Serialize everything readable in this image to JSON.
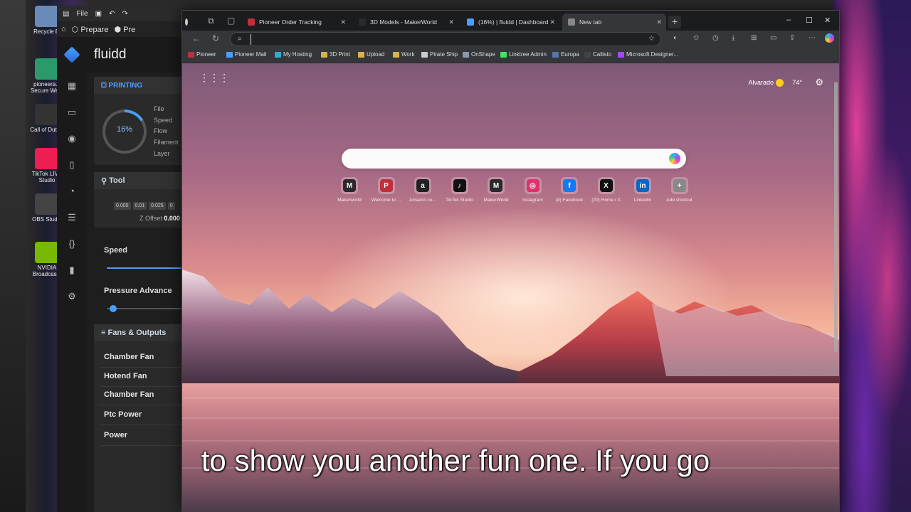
{
  "desktop": {
    "icons": [
      {
        "label": "Recycle Bi",
        "color": "#6a8ab8"
      },
      {
        "label": "pioneera... Secure We...",
        "color": "#2a9a6a"
      },
      {
        "label": "Call of Duty®",
        "color": "#333333"
      },
      {
        "label": "TikTok LIVE Studio",
        "color": "#ee1d52"
      },
      {
        "label": "OBS Studio",
        "color": "#444444"
      },
      {
        "label": "NVIDIA Broadcas...",
        "color": "#76b900"
      }
    ]
  },
  "fluidd": {
    "topbar": {
      "file": "File"
    },
    "tabs": {
      "prepare": "Prepare",
      "preview": "Pre"
    },
    "brand": "fluidd",
    "printing": {
      "header": "PRINTING",
      "progress_label": "16%",
      "progress": 0.16,
      "stats": [
        "File",
        "Speed",
        "Flow",
        "Filament",
        "Layer"
      ]
    },
    "tool": {
      "header": "Tool",
      "z_steps": [
        "0.005",
        "0.01",
        "0.025",
        "0"
      ],
      "z_offset_label": "Z Offset",
      "z_offset_value": "0.000"
    },
    "speed_label": "Speed",
    "pressure_label": "Pressure Advance",
    "fans": {
      "header": "Fans & Outputs",
      "items": [
        "Chamber Fan",
        "Hotend Fan",
        "Chamber Fan",
        "Ptc Power",
        "Power"
      ]
    }
  },
  "browser": {
    "tabs": [
      {
        "title": "Pioneer Order Tracking",
        "color": "#c0303a"
      },
      {
        "title": "3D Models - MakerWorld",
        "color": "#2a2a2a"
      },
      {
        "title": "(16%) | fluidd | Dashboard",
        "color": "#4a9eff"
      },
      {
        "title": "New tab",
        "color": "#888888"
      }
    ],
    "new_tab_symbol": "+",
    "window_controls": [
      "–",
      "☐",
      "✕"
    ],
    "omnibox": {
      "value": "",
      "placeholder": ""
    },
    "bookmarks": [
      {
        "label": "Pioneer",
        "color": "#c0303a"
      },
      {
        "label": "Pioneer Mail",
        "color": "#4a9eff"
      },
      {
        "label": "My Hosting",
        "color": "#33aacc"
      },
      {
        "label": "3D Print",
        "color": "#d9b34a"
      },
      {
        "label": "Upload",
        "color": "#d9b34a"
      },
      {
        "label": "Work",
        "color": "#d9b34a"
      },
      {
        "label": "Pirate Ship",
        "color": "#cccccc"
      },
      {
        "label": "OnShape",
        "color": "#8899aa"
      },
      {
        "label": "Linktree Admin",
        "color": "#43e55e"
      },
      {
        "label": "Europa",
        "color": "#5577aa"
      },
      {
        "label": "Callisto",
        "color": "#444444"
      },
      {
        "label": "Microsoft Designer...",
        "color": "#a14aff"
      }
    ]
  },
  "ntp": {
    "user": "Alvarado",
    "temperature": "74°",
    "search_placeholder": "",
    "shortcuts": [
      {
        "label": "Makerworld",
        "glyph": "M",
        "color": "#2a2a2a"
      },
      {
        "label": "Welcome to ...",
        "glyph": "P",
        "color": "#c0303a"
      },
      {
        "label": "Amazon.co...",
        "glyph": "a",
        "color": "#222222"
      },
      {
        "label": "TikTok Studio",
        "glyph": "♪",
        "color": "#111111"
      },
      {
        "label": "MakerWorld",
        "glyph": "M",
        "color": "#2a2a2a"
      },
      {
        "label": "Instagram",
        "glyph": "◎",
        "color": "#e1306c"
      },
      {
        "label": "(8) Facebook",
        "glyph": "f",
        "color": "#1877f2"
      },
      {
        "label": "(20) Home / X",
        "glyph": "X",
        "color": "#111111"
      },
      {
        "label": "LinkedIn",
        "glyph": "in",
        "color": "#0a66c2"
      },
      {
        "label": "Add shortcut",
        "glyph": "+",
        "color": "#888888"
      }
    ]
  },
  "caption": "to show you another fun one. If you go"
}
